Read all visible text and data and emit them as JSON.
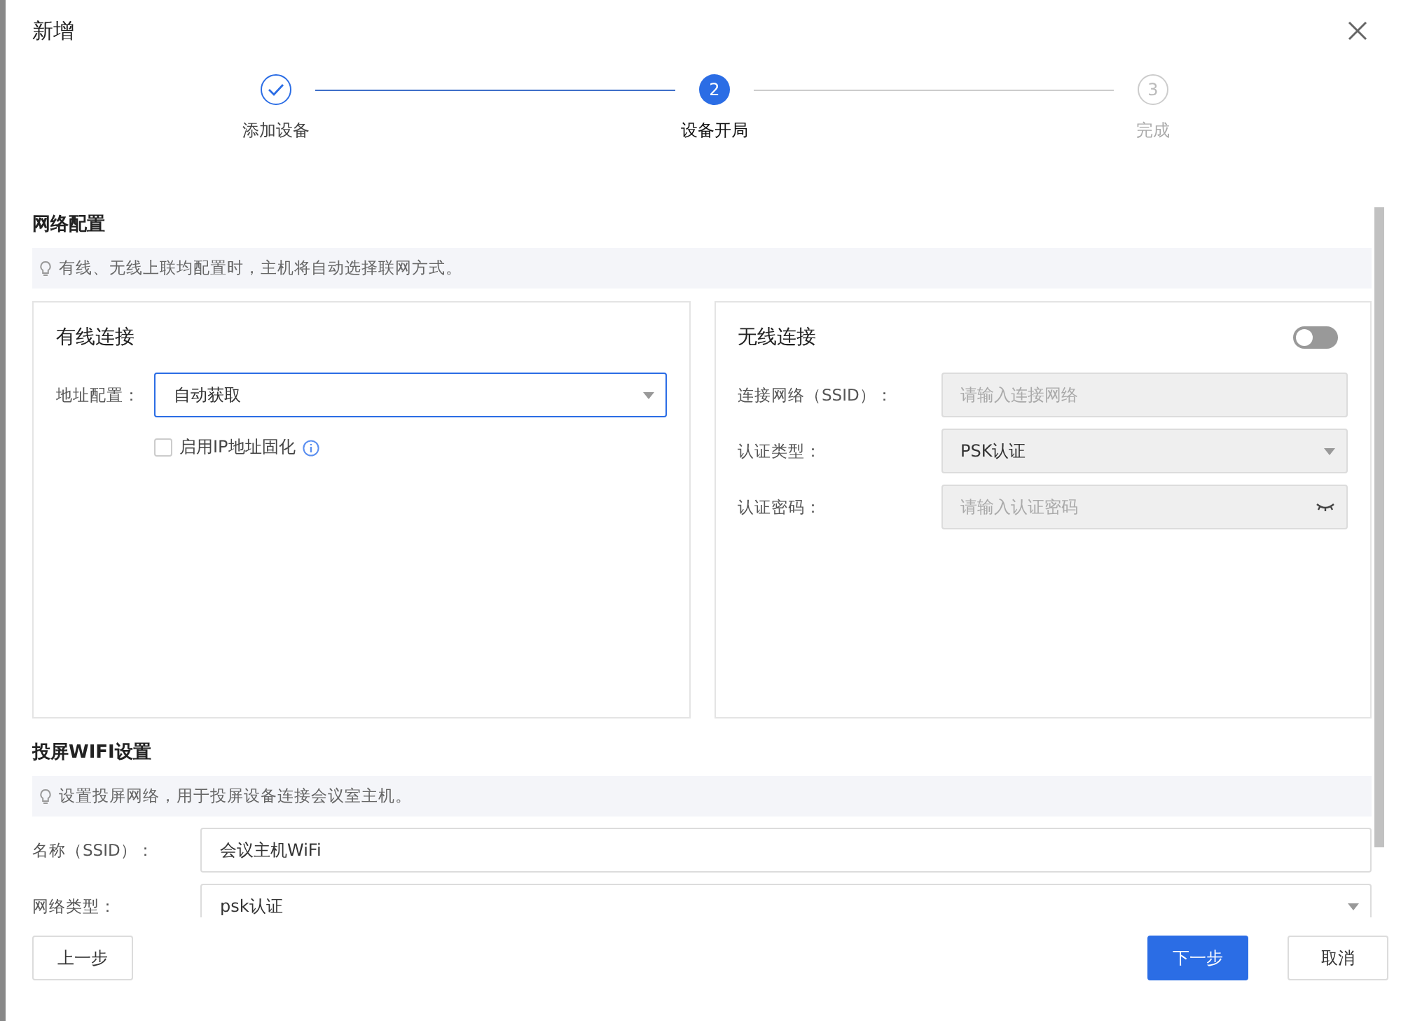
{
  "dialog": {
    "title": "新增"
  },
  "steps": [
    {
      "label": "添加设备",
      "completed": true,
      "selected": false
    },
    {
      "label": "设备开局",
      "number": "2",
      "completed": false,
      "selected": true
    },
    {
      "label": "完成",
      "number": "3",
      "completed": false,
      "selected": false
    }
  ],
  "network": {
    "title": "网络配置",
    "tip": "有线、无线上联均配置时，主机将自动选择联网方式。",
    "wired": {
      "title": "有线连接",
      "address_label": "地址配置：",
      "address_value": "自动获取",
      "fixed_ip": {
        "label": "启用IP地址固化",
        "checked": false
      }
    },
    "wireless": {
      "title": "无线连接",
      "on": false,
      "fields": [
        {
          "kind": "input",
          "label": "连接网络（SSID）：",
          "placeholder": "请输入连接网络"
        },
        {
          "kind": "select",
          "label": "认证类型：",
          "value": "PSK认证"
        },
        {
          "kind": "password",
          "label": "认证密码：",
          "placeholder": "请输入认证密码"
        }
      ]
    }
  },
  "projection": {
    "title": "投屏WIFI设置",
    "tip": "设置投屏网络，用于投屏设备连接会议室主机。",
    "fields": [
      {
        "kind": "input",
        "label": "名称（SSID）：",
        "value": "会议主机WiFi"
      },
      {
        "kind": "select",
        "label": "网络类型：",
        "value": "psk认证"
      }
    ]
  },
  "buttons": {
    "prev": "上一步",
    "next": "下一步",
    "cancel": "取消"
  }
}
